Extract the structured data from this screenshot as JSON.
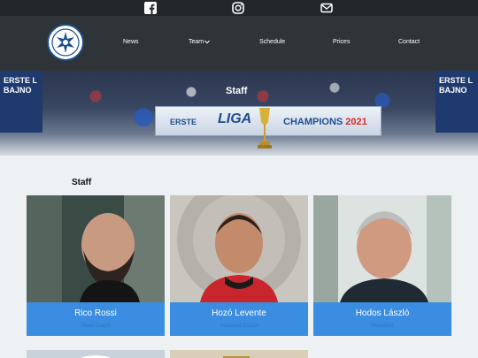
{
  "social": {
    "icons": [
      "facebook-icon",
      "instagram-icon",
      "mail-icon"
    ]
  },
  "nav": {
    "items": [
      {
        "label": "News"
      },
      {
        "label": "Team",
        "caret": "chevron-down-icon"
      },
      {
        "label": "Schedule"
      },
      {
        "label": "Prices"
      },
      {
        "label": "Contact"
      }
    ]
  },
  "hero": {
    "title": "Staff",
    "banner_left": "ERSTE",
    "banner_brand": "LIGA",
    "banner_text": "CHAMPIONS",
    "banner_year": "2021",
    "board_left": "ERSTE L\nBAJNO",
    "board_right": "ERSTE L\nBAJNO"
  },
  "section": {
    "title": "Staff"
  },
  "staff": [
    {
      "name": "Rico Rossi",
      "role": "Head Coach"
    },
    {
      "name": "Hozó Levente",
      "role": "Assistant Coach"
    },
    {
      "name": "Hodos László",
      "role": "President"
    }
  ],
  "colors": {
    "nav_bg": "#2f3439",
    "social_bg": "#23272b",
    "card_accent": "#3a8de0",
    "page_bg": "#eef1f4"
  }
}
